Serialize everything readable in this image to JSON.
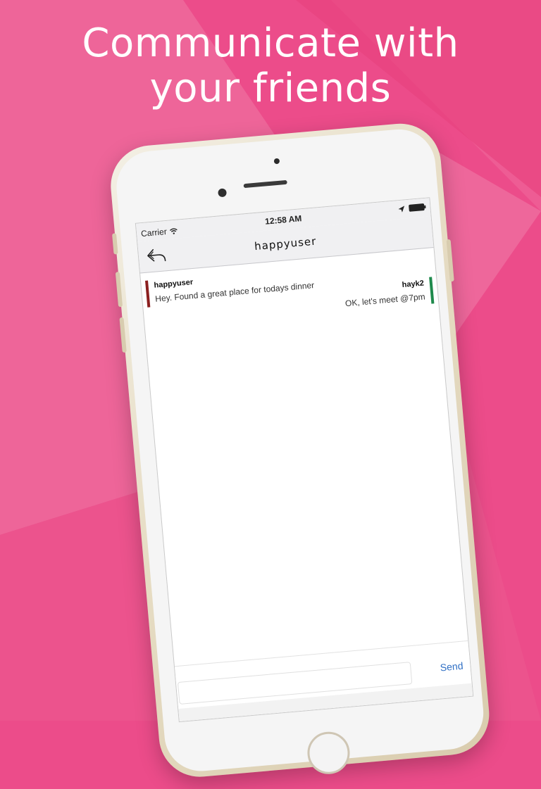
{
  "headline": {
    "line1": "Communicate with",
    "line2": "your friends"
  },
  "colors": {
    "background": "#ec4c8a",
    "incoming_marker": "#8b1f1f",
    "outgoing_marker": "#1f8a4c",
    "send_text": "#2f6fc4"
  },
  "status_bar": {
    "carrier": "Carrier",
    "time": "12:58 AM",
    "icons": [
      "wifi-icon",
      "location-arrow-icon",
      "battery-icon"
    ]
  },
  "nav": {
    "title": "happyuser",
    "back_icon": "back-arrow-icon"
  },
  "messages": [
    {
      "direction": "incoming",
      "sender": "happyuser",
      "text": "Hey. Found a great place for todays dinner"
    },
    {
      "direction": "outgoing",
      "sender": "hayk2",
      "text": "OK, let's meet @7pm"
    }
  ],
  "composer": {
    "input_value": "",
    "send_label": "Send"
  }
}
